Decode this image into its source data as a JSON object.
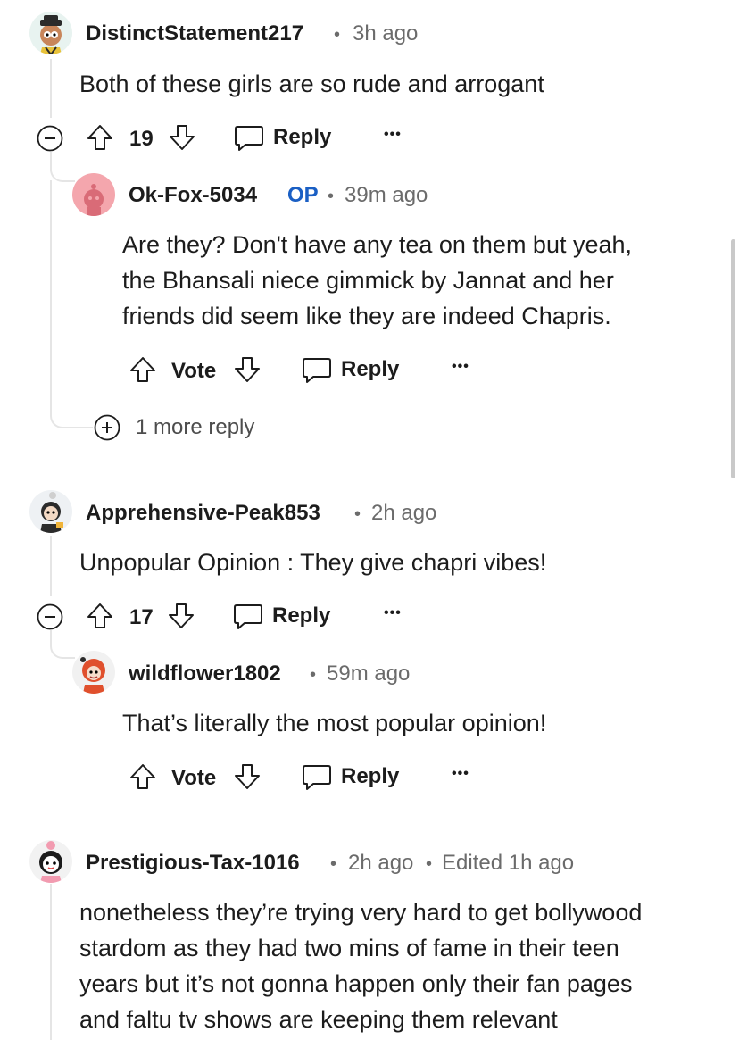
{
  "comments": [
    {
      "username": "DistinctStatement217",
      "time": "3h ago",
      "body": [
        "Both of these girls are so rude and arrogant"
      ],
      "votes": "19",
      "reply_label": "Reply",
      "more_label": "•••",
      "replies": [
        {
          "username": "Ok-Fox-5034",
          "badge": "OP",
          "time": "39m ago",
          "body": [
            "Are they? Don't have any tea on them but yeah,",
            "the Bhansali niece gimmick by Jannat and her",
            "friends did seem like they are indeed Chapris."
          ],
          "vote_label": "Vote",
          "reply_label": "Reply",
          "more_label": "•••"
        }
      ],
      "more_replies_label": "1 more reply"
    },
    {
      "username": "Apprehensive-Peak853",
      "time": "2h ago",
      "body": [
        "Unpopular Opinion : They give chapri vibes!"
      ],
      "votes": "17",
      "reply_label": "Reply",
      "more_label": "•••",
      "replies": [
        {
          "username": "wildflower1802",
          "time": "59m ago",
          "body": [
            "That’s literally the most popular opinion!"
          ],
          "vote_label": "Vote",
          "reply_label": "Reply",
          "more_label": "•••"
        }
      ]
    },
    {
      "username": "Prestigious-Tax-1016",
      "time": "2h ago",
      "edited": "Edited 1h ago",
      "body": [
        "nonetheless they’re trying very hard to get bollywood",
        "stardom as they had two mins of fame in their teen",
        "years but it’s not gonna happen only their fan pages",
        "and faltu tv shows are keeping them relevant"
      ]
    }
  ],
  "separator": "•",
  "colors": {
    "op": "#1a5fc4",
    "meta": "#6b6b6b",
    "line": "#e5e5e5",
    "text": "#1c1c1c"
  }
}
